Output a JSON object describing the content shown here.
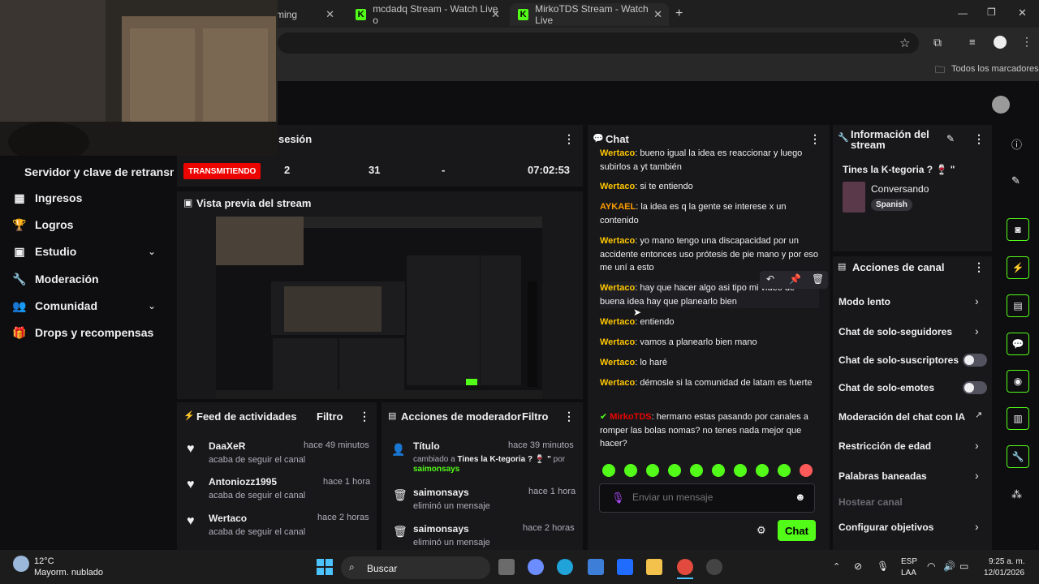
{
  "browser": {
    "tabs": [
      {
        "label": "ming"
      },
      {
        "label": "mcdadq Stream - Watch Live o"
      },
      {
        "label": "MirkoTDS Stream - Watch Live"
      }
    ],
    "new_tab": "+",
    "bookmarks_label": "Todos los marcadores"
  },
  "sidebar": {
    "title": "Servidor y clave de retransm",
    "items": [
      {
        "label": "Ingresos",
        "icon": "coins-icon"
      },
      {
        "label": "Logros",
        "icon": "trophy-icon"
      },
      {
        "label": "Estudio",
        "icon": "studio-icon",
        "expandable": true
      },
      {
        "label": "Moderación",
        "icon": "wrench-icon"
      },
      {
        "label": "Comunidad",
        "icon": "people-icon",
        "expandable": true
      },
      {
        "label": "Drops y recompensas",
        "icon": "gift-icon"
      }
    ]
  },
  "session": {
    "title": "sesión",
    "status": "TRANSMITIENDO",
    "stats": [
      "2",
      "31",
      "-",
      "07:02:53"
    ]
  },
  "preview": {
    "title": "Vista previa del stream"
  },
  "activity": {
    "title": "Feed de actividades",
    "filter": "Filtro",
    "items": [
      {
        "name": "DaaXeR",
        "desc": "acaba de seguir el canal",
        "time": "hace 49 minutos"
      },
      {
        "name": "Antoniozz1995",
        "desc": "acaba de seguir el canal",
        "time": "hace 1 hora"
      },
      {
        "name": "Wertaco",
        "desc": "acaba de seguir el canal",
        "time": "hace 2 horas"
      }
    ]
  },
  "mod_actions": {
    "title": "Acciones de moderador",
    "filter": "Filtro",
    "items": [
      {
        "name": "Título",
        "desc_prefix": "cambiado a",
        "desc_value": "Tines la K-tegoria ? 🍷 \"",
        "desc_suffix": "por",
        "by": "saimonsays",
        "time": "hace 39 minutos"
      },
      {
        "name": "saimonsays",
        "desc": "eliminó un mensaje",
        "time": "hace 1 hora"
      },
      {
        "name": "saimonsays",
        "desc": "eliminó un mensaje",
        "time": "hace 2 horas"
      }
    ]
  },
  "chat": {
    "title": "Chat",
    "messages": [
      {
        "user": "Wertaco",
        "color": "#ffc700",
        "text": "bueno igual la idea es reaccionar y luego subirlos a yt también"
      },
      {
        "user": "Wertaco",
        "color": "#ffc700",
        "text": "si te entiendo"
      },
      {
        "user": "AYKAEL",
        "color": "#ff9d00",
        "text": "la idea es q la gente se interese x un contenido"
      },
      {
        "user": "Wertaco",
        "color": "#ffc700",
        "text": "yo mano tengo una discapacidad por un accidente entonces uso prótesis de pie mano y por eso me uní a esto"
      },
      {
        "user": "Wertaco",
        "color": "#ffc700",
        "text": "hay que hacer algo asi tipo mi video de buena idea hay que planearlo bien"
      },
      {
        "user": "Wertaco",
        "color": "#ffc700",
        "text": "entiendo"
      },
      {
        "user": "Wertaco",
        "color": "#ffc700",
        "text": "vamos a planearlo bien mano"
      },
      {
        "user": "Wertaco",
        "color": "#ffc700",
        "text": "lo haré"
      },
      {
        "user": "Wertaco",
        "color": "#ffc700",
        "text": "démosle si la comunidad de latam es fuerte"
      },
      {
        "user": "MirkoTDS",
        "color": "#eb0400",
        "text": "hermano estas pasando por canales a romper las bolas nomas? no tenes nada mejor que hacer?"
      }
    ],
    "input_placeholder": "Enviar un mensaje",
    "send_label": "Chat"
  },
  "stream_info": {
    "title": "Información del stream",
    "stream_title": "Tines la K-tegoria ? 🍷 \"",
    "category": "Conversando",
    "language": "Spanish"
  },
  "channel_actions": {
    "title": "Acciones de canal",
    "items": [
      {
        "label": "Modo lento",
        "type": "chevron"
      },
      {
        "label": "Chat de solo-seguidores",
        "type": "chevron"
      },
      {
        "label": "Chat de solo-suscriptores",
        "type": "toggle",
        "on": false
      },
      {
        "label": "Chat de solo-emotes",
        "type": "toggle",
        "on": false
      },
      {
        "label": "Moderación del chat con IA",
        "type": "external"
      },
      {
        "label": "Restricción de edad",
        "type": "chevron"
      },
      {
        "label": "Palabras baneadas",
        "type": "chevron"
      },
      {
        "label": "Hostear canal",
        "type": "disabled"
      },
      {
        "label": "Configurar objetivos",
        "type": "chevron"
      }
    ]
  },
  "taskbar": {
    "weather_temp": "12°C",
    "weather_desc": "Mayorm. nublado",
    "search": "Buscar",
    "lang_top": "ESP",
    "lang_bottom": "LAA",
    "time": "9:25 a. m.",
    "date": "12/01/2026"
  },
  "colors": {
    "accent": "#53fc18",
    "live": "#eb0400",
    "panel": "#18181b",
    "bg": "#0e0e10"
  }
}
